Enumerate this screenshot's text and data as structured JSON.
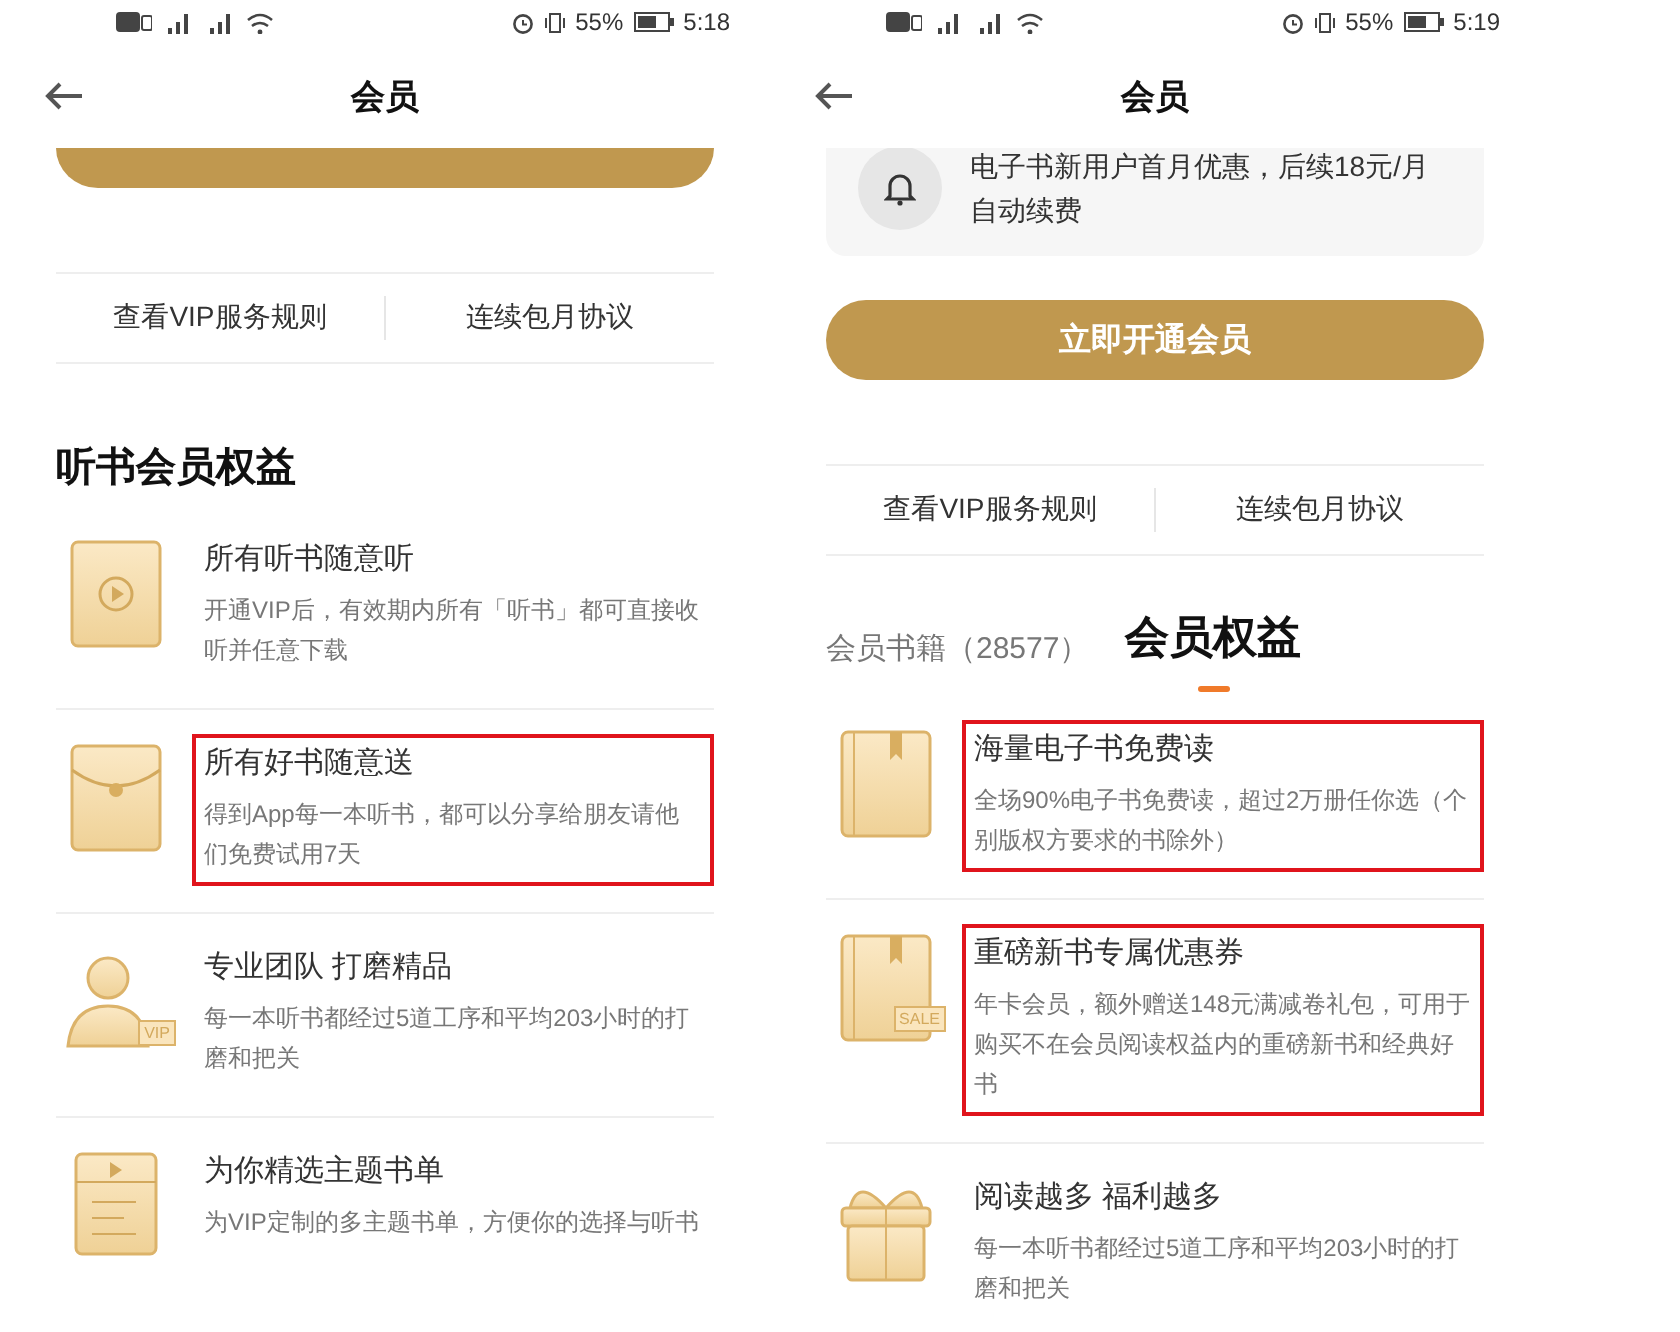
{
  "phones": [
    {
      "status_bar": {
        "battery": "55%",
        "time": "5:18"
      },
      "title": "会员",
      "blocks": [
        {
          "kind": "cut_button"
        },
        {
          "kind": "links",
          "items": [
            "查看VIP服务规则",
            "连续包月协议"
          ]
        },
        {
          "kind": "heading",
          "text": "听书会员权益"
        },
        {
          "kind": "benefits",
          "items": [
            {
              "kind": "play",
              "title": "所有听书随意听",
              "desc": "开通VIP后，有效期内所有「听书」都可直接收听并任意下载",
              "highlighted": false
            },
            {
              "kind": "envelope",
              "title": "所有好书随意送",
              "desc": "得到App每一本听书，都可以分享给朋友请他们免费试用7天",
              "highlighted": true
            },
            {
              "kind": "person",
              "badge": "VIP",
              "title": "专业团队 打磨精品",
              "desc": "每一本听书都经过5道工序和平均203小时的打磨和把关",
              "highlighted": false
            },
            {
              "kind": "list",
              "title": "为你精选主题书单",
              "desc": "为VIP定制的多主题书单，方便你的选择与听书",
              "highlighted": false
            }
          ]
        }
      ]
    },
    {
      "status_bar": {
        "battery": "55%",
        "time": "5:19"
      },
      "title": "会员",
      "blocks": [
        {
          "kind": "notice",
          "text": "电子书新用户首月优惠，后续18元/月自动续费"
        },
        {
          "kind": "button",
          "label": "立即开通会员"
        },
        {
          "kind": "links",
          "items": [
            "查看VIP服务规则",
            "连续包月协议"
          ]
        },
        {
          "kind": "tabs",
          "items": [
            {
              "label": "会员书籍（28577）",
              "selected": false
            },
            {
              "label": "会员权益",
              "selected": true
            }
          ]
        },
        {
          "kind": "benefits",
          "items": [
            {
              "kind": "book",
              "title": "海量电子书免费读",
              "desc": "全场90%电子书免费读，超过2万册任你选（个别版权方要求的书除外）",
              "highlighted": true
            },
            {
              "kind": "book",
              "badge": "SALE",
              "title": "重磅新书专属优惠券",
              "desc": "年卡会员，额外赠送148元满减卷礼包，可用于购买不在会员阅读权益内的重磅新书和经典好书",
              "highlighted": true
            },
            {
              "kind": "gift",
              "title": "阅读越多 福利越多",
              "desc": "每一本听书都经过5道工序和平均203小时的打磨和把关",
              "highlighted": false
            }
          ]
        }
      ]
    }
  ]
}
